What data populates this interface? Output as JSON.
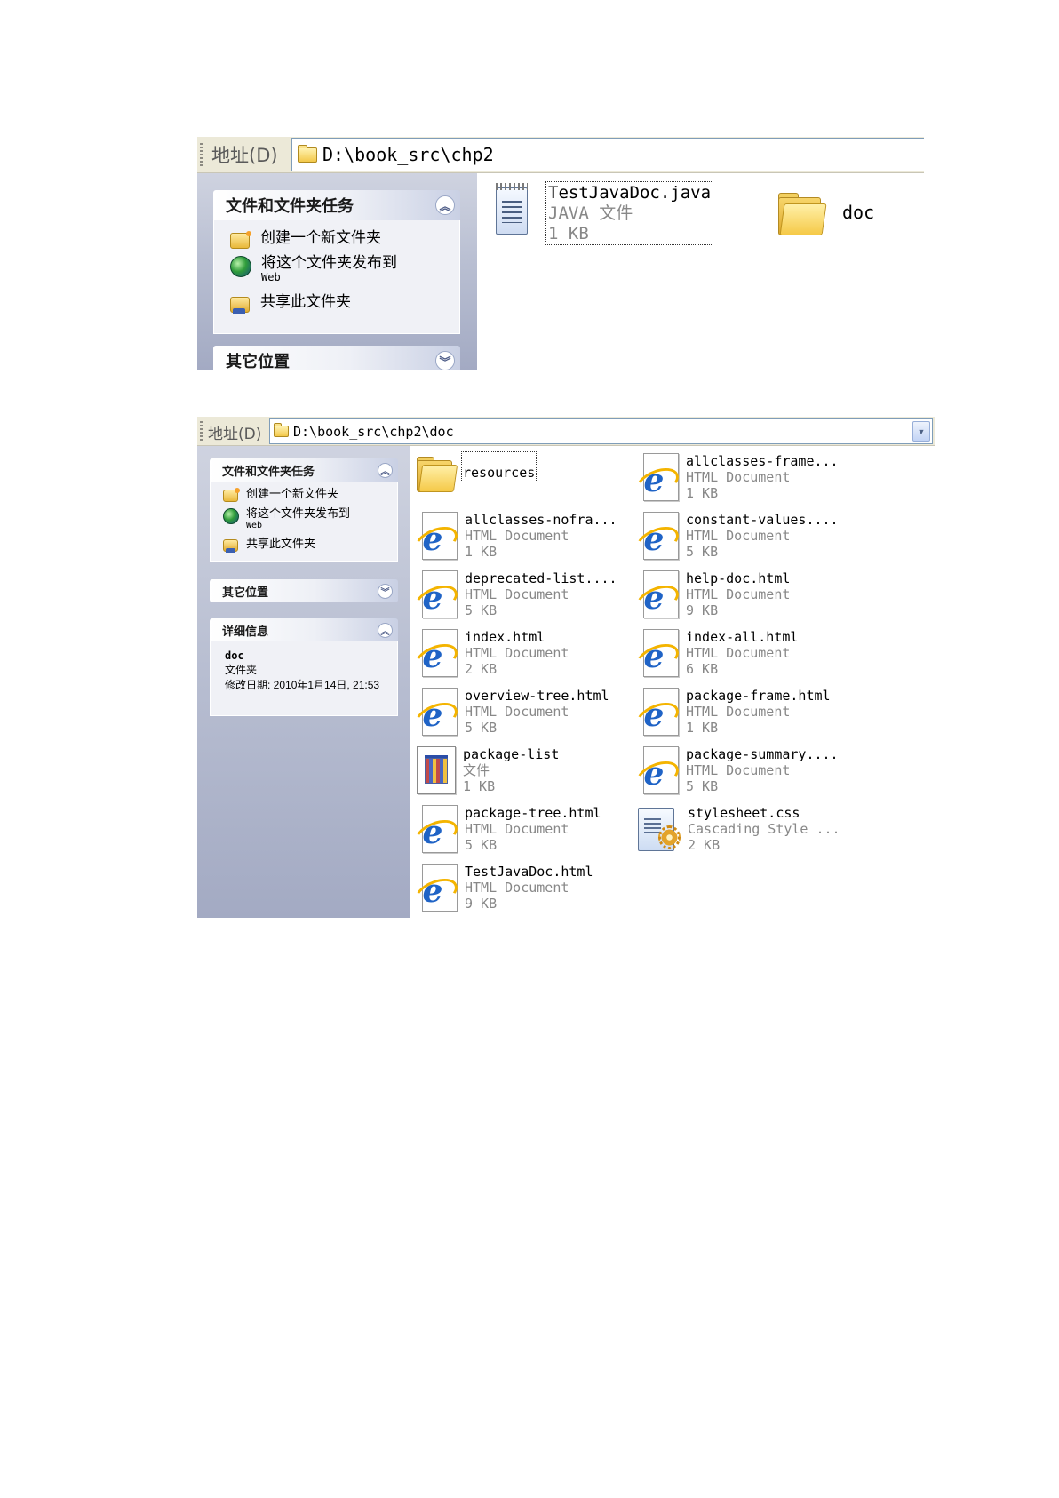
{
  "shot1": {
    "address": {
      "label": "地址(D)",
      "path": "D:\\book_src\\chp2"
    },
    "task_group": {
      "title": "文件和文件夹任务",
      "tasks": [
        "创建一个新文件夹",
        "将这个文件夹发布到",
        "共享此文件夹"
      ],
      "task2_sub": "Web"
    },
    "other_places_title": "其它位置",
    "files": [
      {
        "name": "TestJavaDoc.java",
        "type": "JAVA 文件",
        "size": "1 KB",
        "icon": "notepad-icon"
      },
      {
        "name": "doc",
        "icon": "folder-icon"
      }
    ]
  },
  "shot2": {
    "address": {
      "label": "地址(D)",
      "path": "D:\\book_src\\chp2\\doc"
    },
    "task_group": {
      "title": "文件和文件夹任务",
      "tasks": [
        "创建一个新文件夹",
        "将这个文件夹发布到",
        "共享此文件夹"
      ],
      "task2_sub": "Web"
    },
    "other_places": {
      "title": "其它位置"
    },
    "details": {
      "title": "详细信息",
      "name": "doc",
      "kind": "文件夹",
      "modified": "修改日期: 2010年1月14日, 21:53"
    },
    "files": [
      {
        "name": "resources",
        "type": "",
        "size": "",
        "icon": "folder-icon"
      },
      {
        "name": "allclasses-frame...",
        "type": "HTML Document",
        "size": "1 KB",
        "icon": "ie-html-icon"
      },
      {
        "name": "allclasses-nofra...",
        "type": "HTML Document",
        "size": "1 KB",
        "icon": "ie-html-icon"
      },
      {
        "name": "constant-values....",
        "type": "HTML Document",
        "size": "5 KB",
        "icon": "ie-html-icon"
      },
      {
        "name": "deprecated-list....",
        "type": "HTML Document",
        "size": "5 KB",
        "icon": "ie-html-icon"
      },
      {
        "name": "help-doc.html",
        "type": "HTML Document",
        "size": "9 KB",
        "icon": "ie-html-icon"
      },
      {
        "name": "index.html",
        "type": "HTML Document",
        "size": "2 KB",
        "icon": "ie-html-icon"
      },
      {
        "name": "index-all.html",
        "type": "HTML Document",
        "size": "6 KB",
        "icon": "ie-html-icon"
      },
      {
        "name": "overview-tree.html",
        "type": "HTML Document",
        "size": "5 KB",
        "icon": "ie-html-icon"
      },
      {
        "name": "package-frame.html",
        "type": "HTML Document",
        "size": "1 KB",
        "icon": "ie-html-icon"
      },
      {
        "name": "package-list",
        "type": "文件",
        "size": "1 KB",
        "icon": "generic-file-icon"
      },
      {
        "name": "package-summary....",
        "type": "HTML Document",
        "size": "5 KB",
        "icon": "ie-html-icon"
      },
      {
        "name": "package-tree.html",
        "type": "HTML Document",
        "size": "5 KB",
        "icon": "ie-html-icon"
      },
      {
        "name": "stylesheet.css",
        "type": "Cascading Style ...",
        "size": "2 KB",
        "icon": "css-icon"
      },
      {
        "name": "TestJavaDoc.html",
        "type": "HTML Document",
        "size": "9 KB",
        "icon": "ie-html-icon"
      }
    ]
  }
}
